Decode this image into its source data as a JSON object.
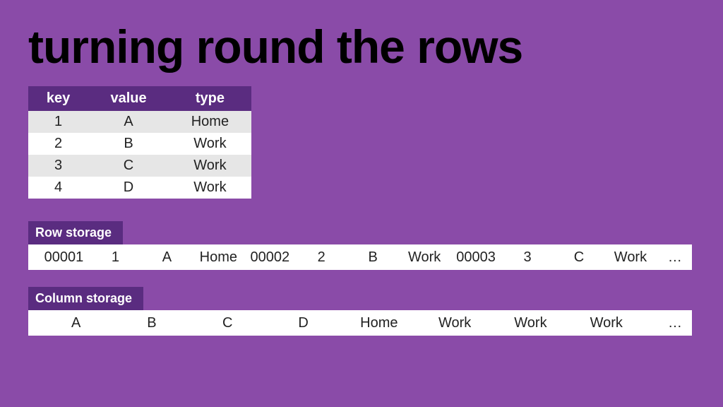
{
  "title": "turning round the rows",
  "table": {
    "headers": [
      "key",
      "value",
      "type"
    ],
    "rows": [
      [
        "1",
        "A",
        "Home"
      ],
      [
        "2",
        "B",
        "Work"
      ],
      [
        "3",
        "C",
        "Work"
      ],
      [
        "4",
        "D",
        "Work"
      ]
    ]
  },
  "row_storage": {
    "label": "Row storage",
    "cells": [
      "00001",
      "1",
      "A",
      "Home",
      "00002",
      "2",
      "B",
      "Work",
      "00003",
      "3",
      "C",
      "Work",
      "…"
    ]
  },
  "column_storage": {
    "label": "Column storage",
    "cells": [
      "A",
      "B",
      "C",
      "D",
      "Home",
      "Work",
      "Work",
      "Work",
      "…"
    ]
  }
}
